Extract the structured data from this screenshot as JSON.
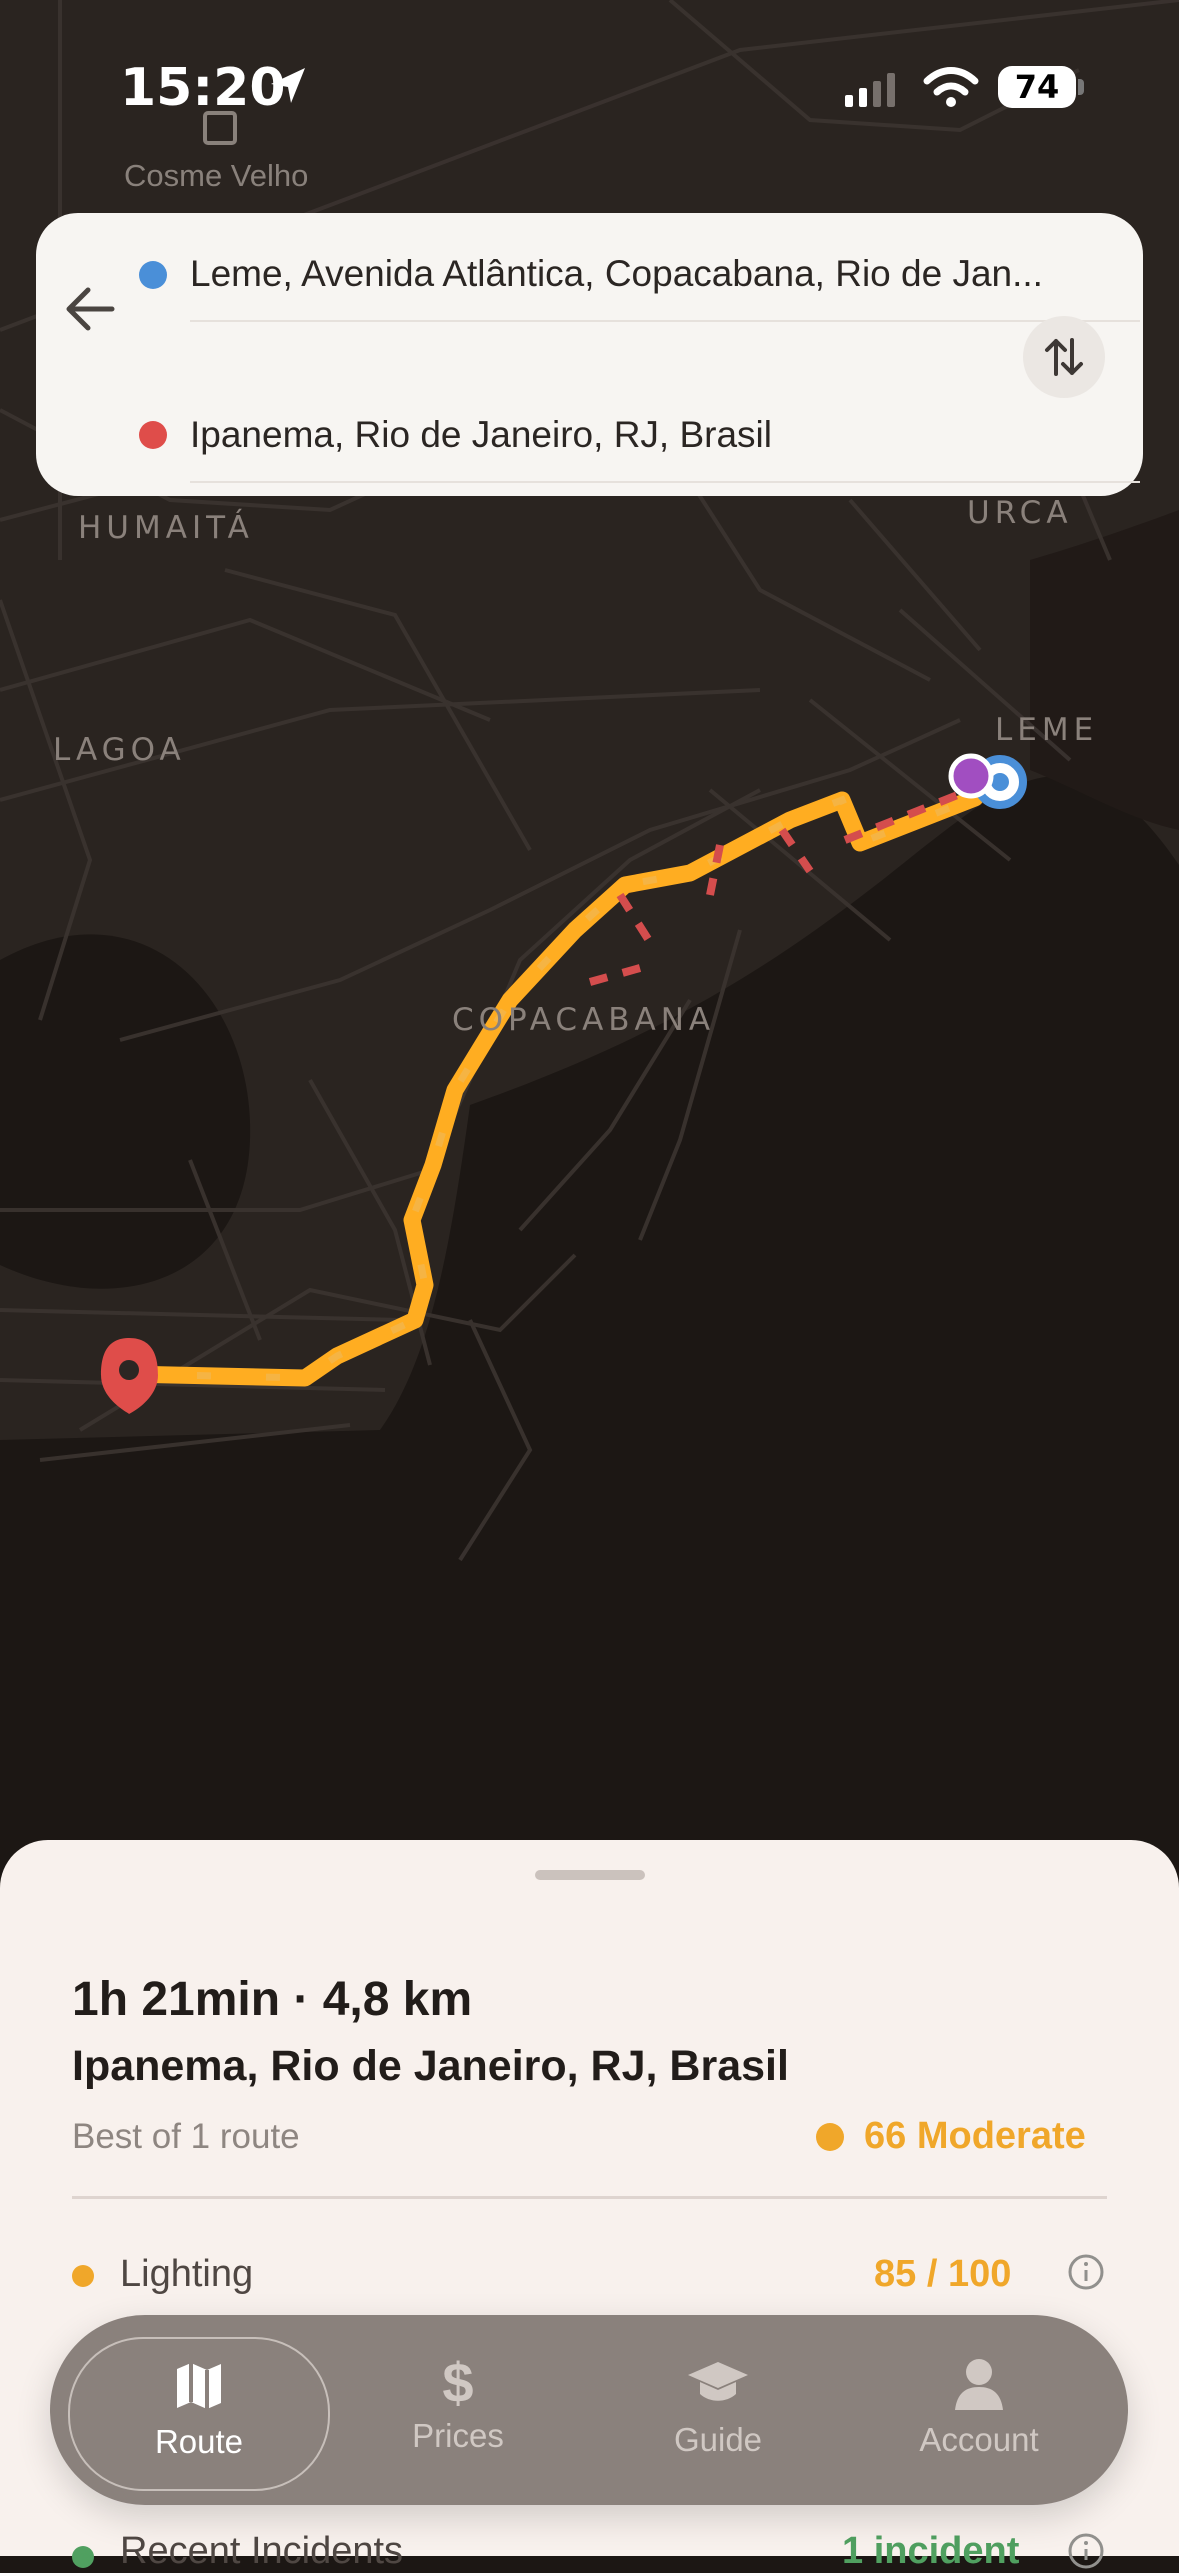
{
  "status": {
    "time": "15:20",
    "battery": "74"
  },
  "map": {
    "station": "Cosme Velho",
    "labels": [
      "HUMAITÁ",
      "LAGOA",
      "URCA",
      "LEME",
      "COPACABANA"
    ],
    "colors": {
      "route": "#f0a72a",
      "danger": "#d44d4d",
      "origin": "#4a8fd8",
      "destination": "#df4d4a",
      "current": "#a14ec1"
    }
  },
  "search": {
    "origin": "Leme, Avenida Atlântica, Copacabana, Rio de Jan...",
    "destination": "Ipanema, Rio de Janeiro, RJ, Brasil"
  },
  "summary": {
    "duration_distance": "1h 21min · 4,8 km",
    "destination": "Ipanema, Rio de Janeiro, RJ, Brasil",
    "subtitle": "Best of 1 route",
    "rating": "66 Moderate",
    "metrics": [
      {
        "name": "Lighting",
        "value": "85 / 100"
      },
      {
        "name": "Recent Incidents",
        "value": "1 incident"
      }
    ]
  },
  "tabs": [
    "Route",
    "Prices",
    "Guide",
    "Account"
  ],
  "icons": [
    "location-arrow-icon",
    "signal-icon",
    "wifi-icon",
    "battery-icon",
    "back-arrow-icon",
    "swap-icon",
    "info-icon",
    "map-icon",
    "dollar-icon",
    "graduation-cap-icon",
    "person-icon"
  ]
}
